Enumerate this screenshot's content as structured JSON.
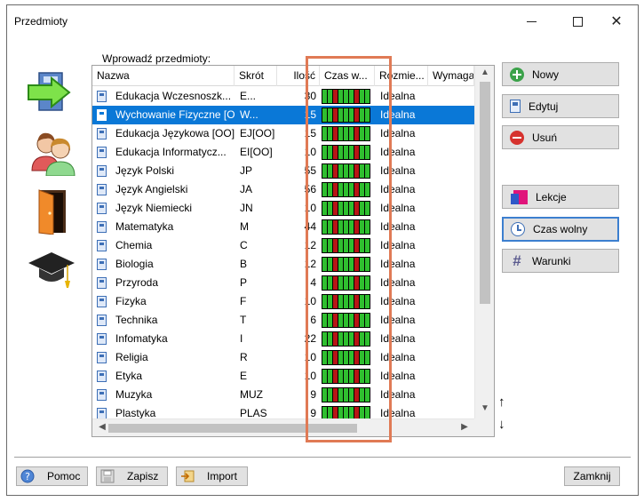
{
  "window": {
    "title": "Przedmioty"
  },
  "grid": {
    "label": "Wprowadź przedmioty:",
    "columns": [
      "Nazwa",
      "Skrót",
      "Ilość",
      "Czas w...",
      "Rozmie...",
      "Wymaga"
    ],
    "rows": [
      {
        "name": "Edukacja Wczesnoszk...",
        "abbr": "E...",
        "qty": "30",
        "size": "Idealna"
      },
      {
        "name": "Wychowanie Fizyczne [OO]",
        "abbr": "W...",
        "qty": "15",
        "size": "Idealna",
        "selected": true
      },
      {
        "name": "Edukacja Językowa [OO]",
        "abbr": "EJ[OO]",
        "qty": "15",
        "size": "Idealna"
      },
      {
        "name": "Edukacja Informatycz...",
        "abbr": "EI[OO]",
        "qty": "10",
        "size": "Idealna"
      },
      {
        "name": "Język Polski",
        "abbr": "JP",
        "qty": "55",
        "size": "Idealna"
      },
      {
        "name": "Język Angielski",
        "abbr": "JA",
        "qty": "56",
        "size": "Idealna"
      },
      {
        "name": "Język Niemiecki",
        "abbr": "JN",
        "qty": "10",
        "size": "Idealna"
      },
      {
        "name": "Matematyka",
        "abbr": "M",
        "qty": "44",
        "size": "Idealna"
      },
      {
        "name": "Chemia",
        "abbr": "C",
        "qty": "12",
        "size": "Idealna"
      },
      {
        "name": "Biologia",
        "abbr": "B",
        "qty": "12",
        "size": "Idealna"
      },
      {
        "name": "Przyroda",
        "abbr": "P",
        "qty": "4",
        "size": "Idealna"
      },
      {
        "name": "Fizyka",
        "abbr": "F",
        "qty": "10",
        "size": "Idealna"
      },
      {
        "name": "Technika",
        "abbr": "T",
        "qty": "6",
        "size": "Idealna"
      },
      {
        "name": "Infomatyka",
        "abbr": "I",
        "qty": "22",
        "size": "Idealna"
      },
      {
        "name": "Religia",
        "abbr": "R",
        "qty": "10",
        "size": "Idealna"
      },
      {
        "name": "Etyka",
        "abbr": "E",
        "qty": "10",
        "size": "Idealna"
      },
      {
        "name": "Muzyka",
        "abbr": "MUZ",
        "qty": "9",
        "size": "Idealna"
      },
      {
        "name": "Plastyka",
        "abbr": "PLAS",
        "qty": "9",
        "size": "Idealna"
      }
    ]
  },
  "buttons": {
    "new": "Nowy",
    "edit": "Edytuj",
    "delete": "Usuń",
    "lessons": "Lekcje",
    "free_time": "Czas wolny",
    "conditions": "Warunki",
    "move_up": "↑",
    "move_down": "↓"
  },
  "footer": {
    "help": "Pomoc",
    "save": "Zapisz",
    "import": "Import",
    "close": "Zamknij"
  },
  "icons": {
    "sidebar": [
      "subjects-arrow-icon",
      "teachers-icon",
      "classrooms-door-icon",
      "classes-graduation-cap-icon"
    ],
    "new": "plus-circle-icon",
    "edit": "document-edit-icon",
    "delete": "minus-circle-icon",
    "lessons": "lessons-icon",
    "free_time": "clock-icon",
    "conditions": "hash-icon"
  },
  "colors": {
    "selection": "#0a78d7",
    "timebar_green": "#2fbf2f",
    "timebar_red": "#b81515",
    "highlight": "#e07a55",
    "active_button_border": "#3c7fcf"
  }
}
